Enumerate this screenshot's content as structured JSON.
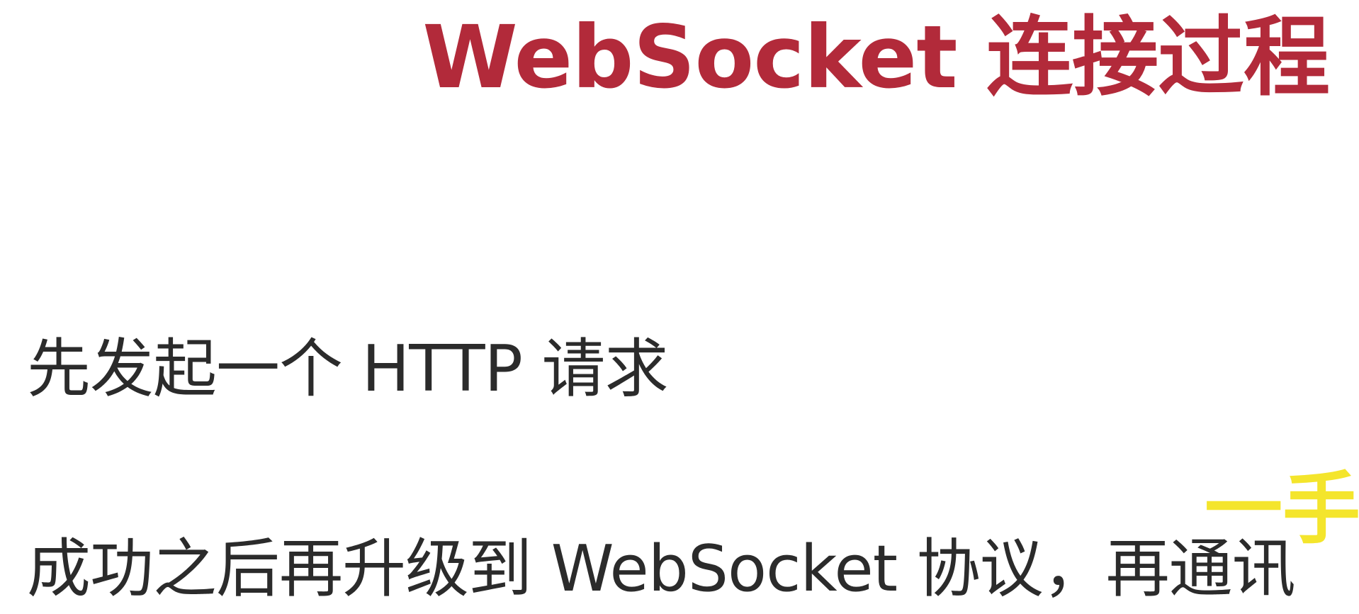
{
  "slide": {
    "title": "WebSocket 连接过程",
    "bullets": [
      "先发起一个 HTTP 请求",
      "成功之后再升级到 WebSocket 协议，再通讯"
    ],
    "annotation_fragment": "一手",
    "colors": {
      "title": "#b22a3a",
      "body": "#2b2b2b",
      "annotation": "#f4e52c",
      "background": "#ffffff"
    }
  }
}
